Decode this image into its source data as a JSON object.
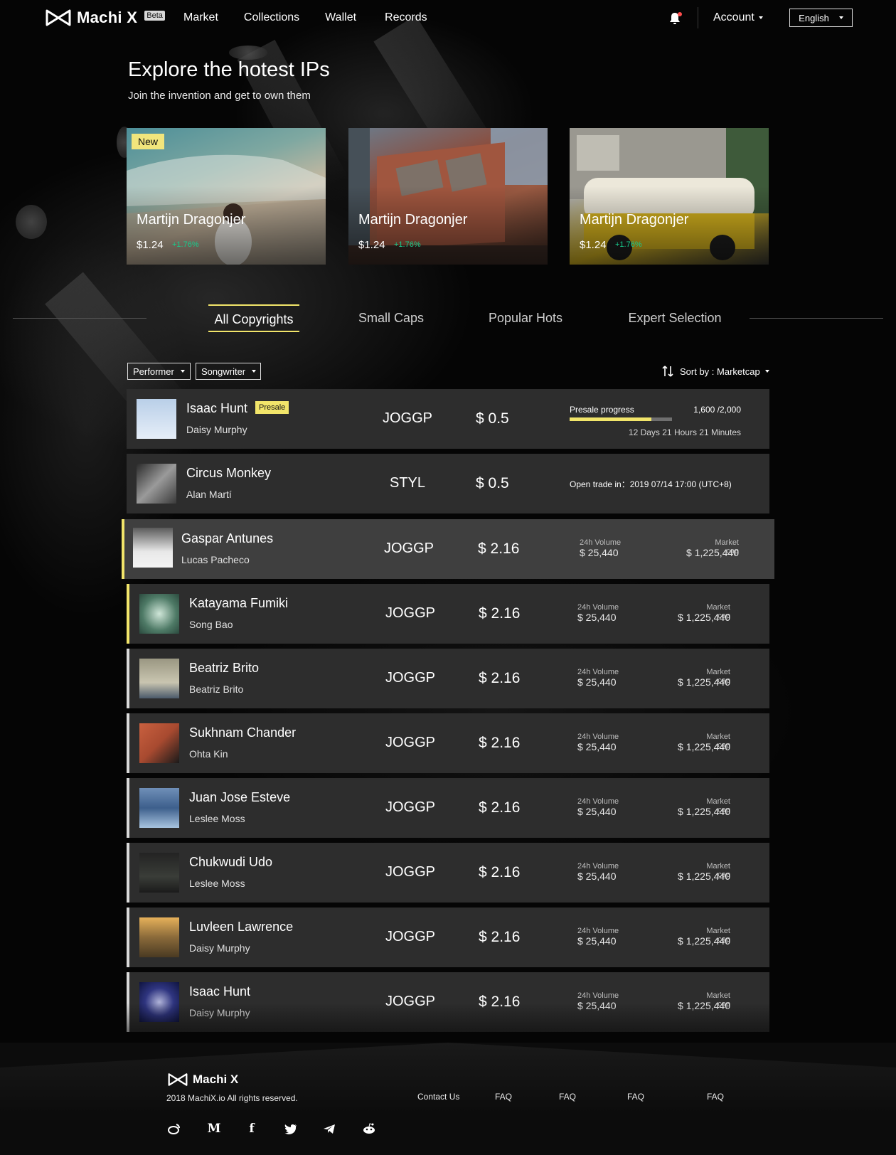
{
  "header": {
    "brand": "Machi X",
    "beta": "Beta",
    "nav": [
      "Market",
      "Collections",
      "Wallet",
      "Records"
    ],
    "account": "Account",
    "language": "English"
  },
  "hero": {
    "title": "Explore the hotest IPs",
    "subtitle": "Join the invention and get to own them"
  },
  "cards": [
    {
      "badge": "New",
      "title": "Martijn Dragonjer",
      "price": "$1.24",
      "change": "+1.76%"
    },
    {
      "badge": "",
      "title": "Martijn Dragonjer",
      "price": "$1.24",
      "change": "+1.76%"
    },
    {
      "badge": "",
      "title": "Martijn Dragonjer",
      "price": "$1.24",
      "change": "+1.76%"
    }
  ],
  "tabs": [
    "All Copyrights",
    "Small Caps",
    "Popular Hots",
    "Expert Selection"
  ],
  "filters": {
    "performer": "Performer",
    "songwriter": "Songwriter",
    "sort": "Sort by : Marketcap"
  },
  "rows": [
    {
      "name": "Isaac Hunt",
      "artist": "Daisy Murphy",
      "badge": "Presale",
      "code": "JOGGP",
      "price": "$ 0.5",
      "presale_label": "Presale progress",
      "presale_count": "1,600 /2,000",
      "presale_progress": 0.8,
      "presale_time": "12 Days  21 Hours 21 Minutes"
    },
    {
      "name": "Circus Monkey",
      "artist": "Alan Martí",
      "code": "STYL",
      "price": "$ 0.5",
      "open_trade": "Open trade in：2019 07/14 17:00 (UTC+8)"
    },
    {
      "name": "Gaspar Antunes",
      "artist": "Lucas Pacheco",
      "code": "JOGGP",
      "price": "$ 2.16",
      "vol_label": "24h Volume",
      "vol": "$ 25,440",
      "cap_label": "Market cap",
      "cap": "$ 1,225,440"
    },
    {
      "name": "Katayama Fumiki",
      "artist": "Song Bao",
      "code": "JOGGP",
      "price": "$ 2.16",
      "vol_label": "24h Volume",
      "vol": "$ 25,440",
      "cap_label": "Market cap",
      "cap": "$ 1,225,440"
    },
    {
      "name": "Beatriz Brito",
      "artist": "Beatriz Brito",
      "code": "JOGGP",
      "price": "$ 2.16",
      "vol_label": "24h Volume",
      "vol": "$ 25,440",
      "cap_label": "Market cap",
      "cap": "$ 1,225,440"
    },
    {
      "name": "Sukhnam Chander",
      "artist": "Ohta Kin",
      "code": "JOGGP",
      "price": "$ 2.16",
      "vol_label": "24h Volume",
      "vol": "$ 25,440",
      "cap_label": "Market cap",
      "cap": "$ 1,225,440"
    },
    {
      "name": "Juan Jose Esteve",
      "artist": "Leslee Moss",
      "code": "JOGGP",
      "price": "$ 2.16",
      "vol_label": "24h Volume",
      "vol": "$ 25,440",
      "cap_label": "Market cap",
      "cap": "$ 1,225,440"
    },
    {
      "name": "Chukwudi Udo",
      "artist": "Leslee Moss",
      "code": "JOGGP",
      "price": "$ 2.16",
      "vol_label": "24h Volume",
      "vol": "$ 25,440",
      "cap_label": "Market cap",
      "cap": "$ 1,225,440"
    },
    {
      "name": "Luvleen Lawrence",
      "artist": "Daisy Murphy",
      "code": "JOGGP",
      "price": "$ 2.16",
      "vol_label": "24h Volume",
      "vol": "$ 25,440",
      "cap_label": "Market cap",
      "cap": "$ 1,225,440"
    },
    {
      "name": "Isaac Hunt",
      "artist": "Daisy Murphy",
      "code": "JOGGP",
      "price": "$ 2.16",
      "vol_label": "24h Volume",
      "vol": "$ 25,440",
      "cap_label": "Market cap",
      "cap": "$ 1,225,440"
    }
  ],
  "footer": {
    "brand": "Machi X",
    "copyright": "2018 MachiX.io All rights reserved.",
    "links": [
      "Contact Us",
      "FAQ",
      "FAQ",
      "FAQ",
      "FAQ"
    ],
    "social_icons": [
      "weibo-icon",
      "medium-icon",
      "facebook-icon",
      "twitter-icon",
      "telegram-icon",
      "reddit-icon"
    ]
  },
  "colors": {
    "accent": "#f2e56a",
    "positive": "#18c98b",
    "row_bg": "#2d2d2d",
    "row_highlight": "#3f3f3f"
  }
}
